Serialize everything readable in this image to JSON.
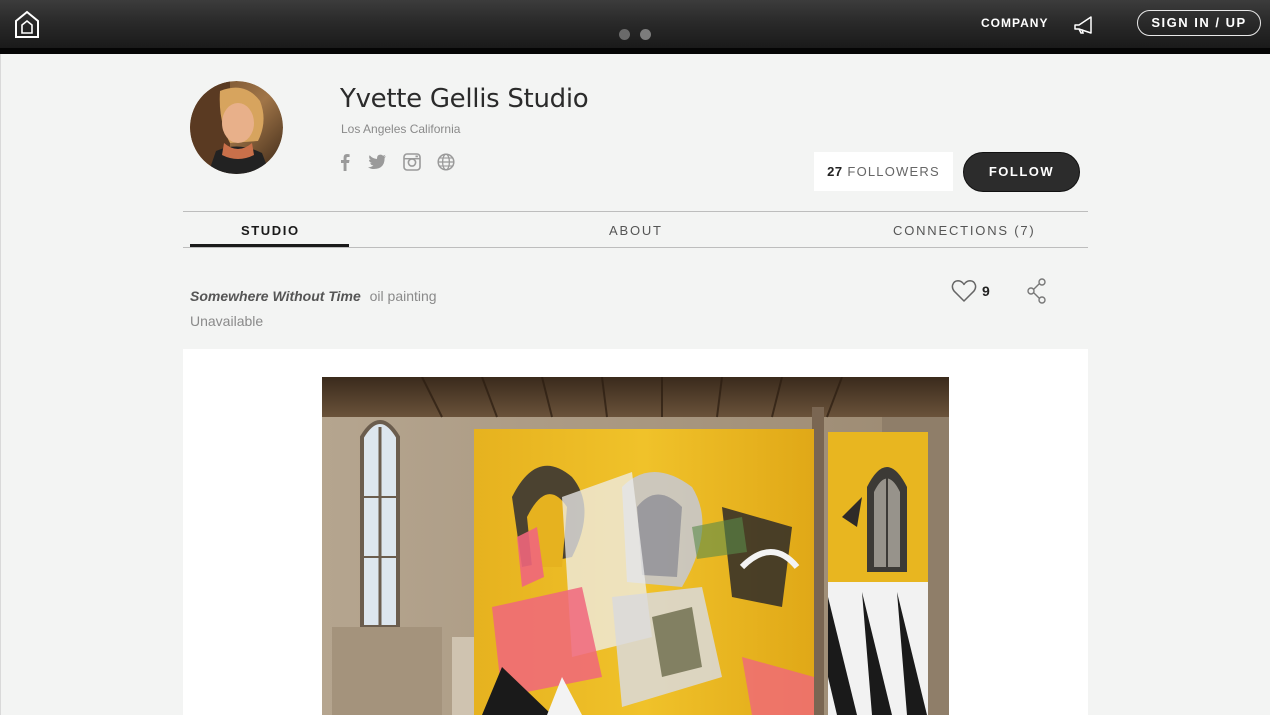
{
  "topbar": {
    "company_label": "COMPANY",
    "sign_label": "SIGN IN / UP",
    "slides": 2,
    "active_slide": 1
  },
  "profile": {
    "name": "Yvette Gellis Studio",
    "location": "Los Angeles California",
    "social_icons": [
      "facebook-icon",
      "twitter-icon",
      "instagram-icon",
      "website-globe-icon"
    ],
    "followers_count": "27",
    "followers_label": "FOLLOWERS",
    "follow_label": "FOLLOW"
  },
  "tabs": [
    {
      "label": "STUDIO",
      "active": true
    },
    {
      "label": "ABOUT",
      "active": false
    },
    {
      "label": "CONNECTIONS (7)",
      "active": false
    }
  ],
  "artwork": {
    "title": "Somewhere Without Time",
    "medium": "oil painting",
    "availability": "Unavailable",
    "likes": "9"
  },
  "colors": {
    "topbar": "#2a2a2a",
    "page_bg": "#f3f4f3",
    "follow_button": "#2c2c2c",
    "painting_yellow": "#e8b620",
    "painting_pink": "#f0667c"
  }
}
